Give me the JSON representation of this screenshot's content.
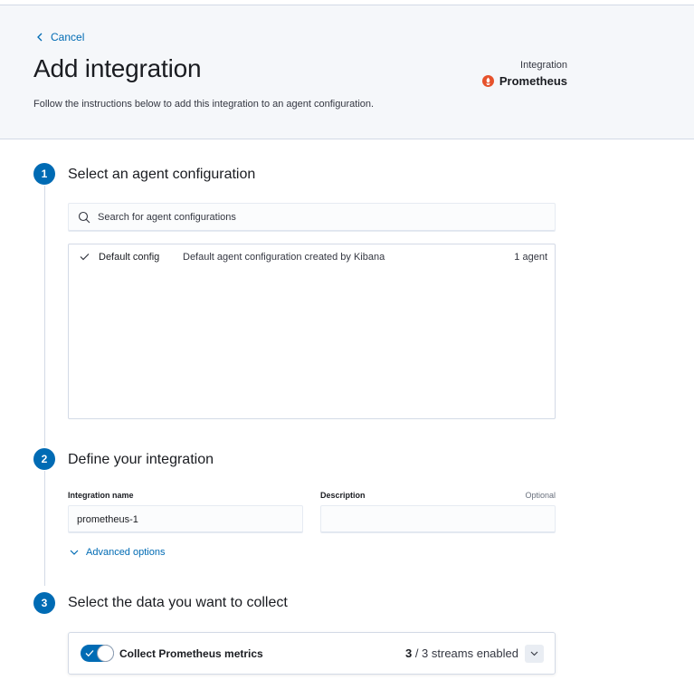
{
  "header": {
    "cancel_label": "Cancel",
    "title": "Add integration",
    "subtitle": "Follow the instructions below to add this integration to an agent configuration.",
    "integration_label": "Integration",
    "integration_name": "Prometheus",
    "integration_icon": "prometheus-icon",
    "integration_color": "#e6522c"
  },
  "steps": [
    {
      "number": "1",
      "title": "Select an agent configuration"
    },
    {
      "number": "2",
      "title": "Define your integration"
    },
    {
      "number": "3",
      "title": "Select the data you want to collect"
    }
  ],
  "agent_configs": {
    "search_placeholder": "Search for agent configurations",
    "items": [
      {
        "name": "Default config",
        "description": "Default agent configuration created by Kibana",
        "count": "1 agent",
        "selected": true
      }
    ]
  },
  "integration_form": {
    "name_label": "Integration name",
    "name_value": "prometheus-1",
    "description_label": "Description",
    "description_optional": "Optional",
    "description_value": "",
    "advanced_label": "Advanced options"
  },
  "data_collection": {
    "input_title": "Collect Prometheus metrics",
    "enabled": true,
    "streams_enabled": "3",
    "streams_text": " / 3 streams enabled"
  },
  "colors": {
    "accent": "#006bb4",
    "header_bg": "#f5f7fa"
  }
}
